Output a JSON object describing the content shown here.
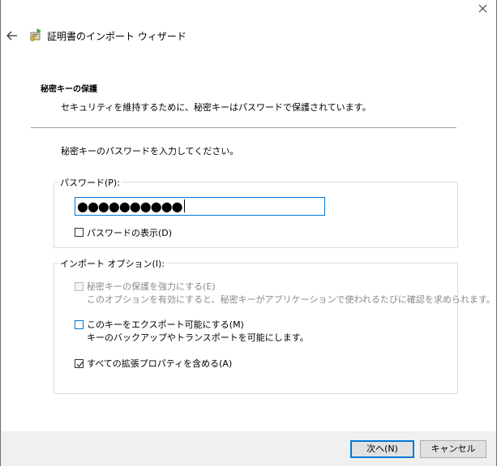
{
  "window": {
    "title": "証明書のインポート ウィザード"
  },
  "header": {
    "section_title": "秘密キーの保護",
    "section_subtitle": "セキュリティを維持するために、秘密キーはパスワードで保護されています。"
  },
  "body": {
    "prompt": "秘密キーのパスワードを入力してください。"
  },
  "password_group": {
    "label": "パスワード(P):",
    "value": "●●●●●●●●●●",
    "show_password_label": "パスワードの表示(D)",
    "show_password_checked": false
  },
  "import_options": {
    "label": "インポート オプション(I):",
    "options": [
      {
        "label": "秘密キーの保護を強力にする(E)",
        "description": "このオプションを有効にすると、秘密キーがアプリケーションで使われるたびに確認を求められます。",
        "checked": false,
        "enabled": false
      },
      {
        "label": "このキーをエクスポート可能にする(M)",
        "description": "キーのバックアップやトランスポートを可能にします。",
        "checked": false,
        "enabled": true
      },
      {
        "label": "すべての拡張プロパティを含める(A)",
        "description": "",
        "checked": true,
        "enabled": true
      }
    ]
  },
  "buttons": {
    "next": "次へ(N)",
    "cancel": "キャンセル"
  },
  "icons": {
    "back": "back-arrow-icon",
    "wizard": "certificate-wizard-icon",
    "close": "close-icon"
  },
  "colors": {
    "accent": "#0078d7",
    "footer_bg": "#f0f0f0"
  }
}
